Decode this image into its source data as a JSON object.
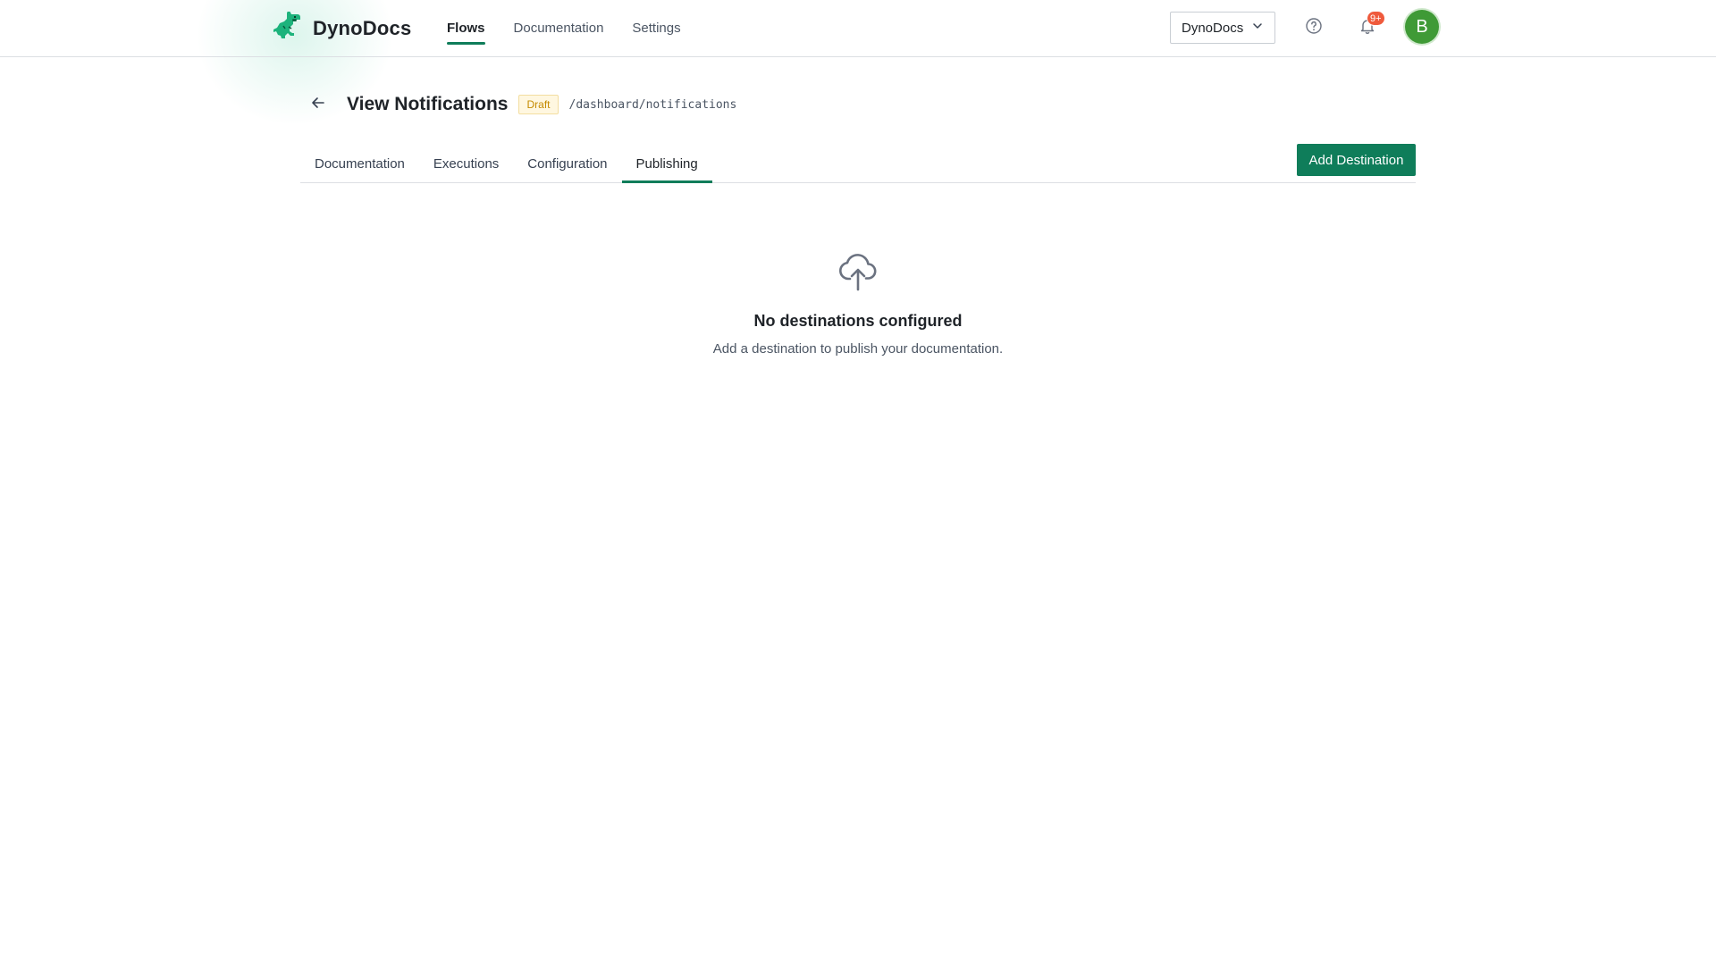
{
  "brand": {
    "name": "DynoDocs"
  },
  "nav": {
    "items": [
      {
        "label": "Flows",
        "active": true
      },
      {
        "label": "Documentation",
        "active": false
      },
      {
        "label": "Settings",
        "active": false
      }
    ]
  },
  "org_select": {
    "value": "DynoDocs"
  },
  "notifications": {
    "badge": "9+"
  },
  "user": {
    "avatar_initial": "B"
  },
  "page": {
    "title": "View Notifications",
    "status": "Draft",
    "path": "/dashboard/notifications"
  },
  "tabs": [
    {
      "label": "Documentation",
      "active": false
    },
    {
      "label": "Executions",
      "active": false
    },
    {
      "label": "Configuration",
      "active": false
    },
    {
      "label": "Publishing",
      "active": true
    }
  ],
  "actions": {
    "add_destination": "Add Destination"
  },
  "empty_state": {
    "icon": "cloud-upload-icon",
    "title": "No destinations configured",
    "description": "Add a destination to publish your documentation."
  },
  "colors": {
    "accent": "#0f7d5a",
    "badge": "#ef5a3c",
    "avatar": "#3f9a36",
    "draft": "#c58b00"
  }
}
